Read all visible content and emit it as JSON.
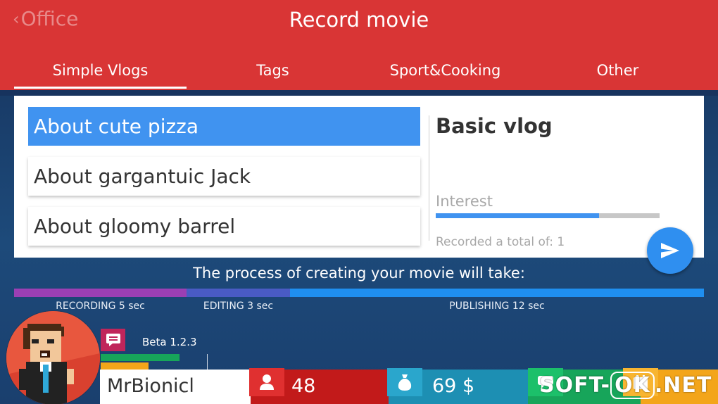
{
  "header": {
    "back_label": "Office",
    "title": "Record movie",
    "tabs": [
      {
        "label": "Simple Vlogs",
        "active": true
      },
      {
        "label": "Tags",
        "active": false
      },
      {
        "label": "Sport&Cooking",
        "active": false
      },
      {
        "label": "Other",
        "active": false
      }
    ],
    "color": "#d93535"
  },
  "topics": [
    {
      "label": "About cute pizza",
      "selected": true
    },
    {
      "label": "About gargantuic Jack",
      "selected": false
    },
    {
      "label": "About gloomy barrel",
      "selected": false
    }
  ],
  "detail": {
    "title": "Basic vlog",
    "interest_label": "Interest",
    "interest_level": 0.73,
    "recorded_text": "Recorded a total of: 1"
  },
  "process": {
    "heading": "The process of creating your movie will take:",
    "stages": [
      {
        "label": "RECORDING 5 sec",
        "seconds": 5,
        "color": "#9b3fb4"
      },
      {
        "label": "EDITING 3 sec",
        "seconds": 3,
        "color": "#4a5bc4"
      },
      {
        "label": "PUBLISHING 12 sec",
        "seconds": 12,
        "color": "#1f8ff0"
      }
    ]
  },
  "player": {
    "version": "Beta 1.2.3",
    "username": "MrBionicl"
  },
  "stats": {
    "followers": "48",
    "money": "69 $"
  },
  "icons": {
    "back": "chevron-left-icon",
    "send": "send-icon",
    "message": "message-icon",
    "followers": "user-icon",
    "money": "money-bag-icon",
    "chat": "chat-icon",
    "calendar": "calendar-icon"
  },
  "watermark": {
    "left": "SOFT-",
    "ok": "OK",
    "right": ".NET"
  }
}
